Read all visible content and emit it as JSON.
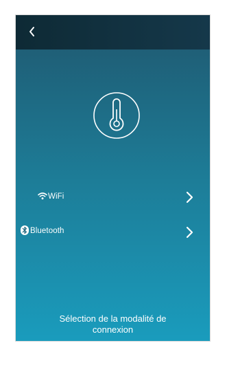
{
  "header": {
    "back_icon": "chevron-left-icon"
  },
  "sensor": {
    "icon": "thermometer-icon"
  },
  "connection_options": [
    {
      "icon": "wifi-icon",
      "label": "WiFi",
      "arrow_icon": "chevron-right-icon"
    },
    {
      "icon": "bluetooth-icon",
      "label": "Bluetooth",
      "arrow_icon": "chevron-right-icon"
    }
  ],
  "caption": "Sélection de la modalité de\nconnexion",
  "colors": {
    "topbar": "#15384a",
    "gradient_top": "#1f5f77",
    "gradient_bottom": "#1a9cbd",
    "foreground": "#ffffff"
  }
}
